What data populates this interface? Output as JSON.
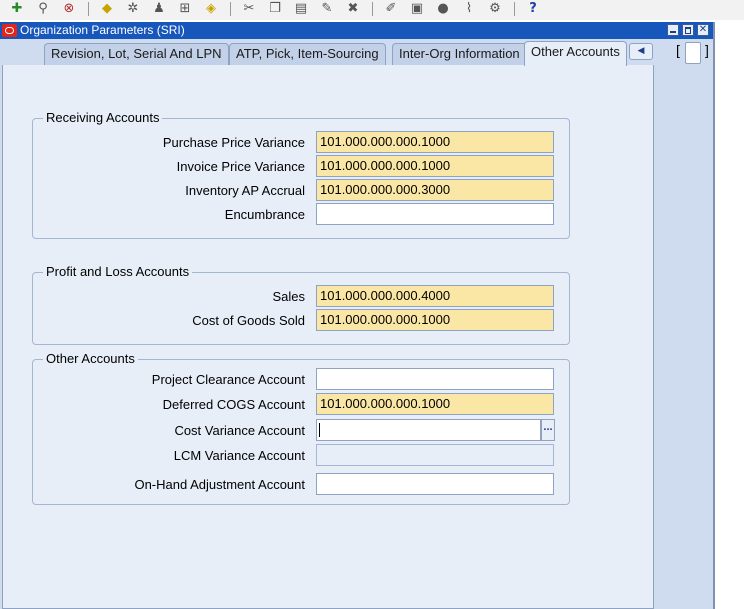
{
  "window": {
    "title": "Organization Parameters (SRI)",
    "close_glyph": "✕"
  },
  "toolbar": {
    "icons": [
      "new-record-icon",
      "find-icon",
      "navigator-icon",
      "save-icon",
      "next-step-icon",
      "switch-responsibility-icon",
      "print-icon",
      "close-form-icon",
      "cut-icon",
      "copy-icon",
      "paste-icon",
      "clear-record-icon",
      "delete-record-icon",
      "edit-field-icon",
      "zoom-icon",
      "translations-icon",
      "attachments-icon",
      "folder-tools-icon",
      "help-icon"
    ],
    "help_glyph": "?"
  },
  "tabs": [
    {
      "label": "Revision, Lot, Serial And LPN"
    },
    {
      "label": "ATP, Pick, Item-Sourcing"
    },
    {
      "label": "Inter-Org Information"
    },
    {
      "label": "Other Accounts"
    }
  ],
  "tab_scroll_glyph": "◀",
  "bracket": {
    "open": "[",
    "close": "]"
  },
  "receiving": {
    "title": "Receiving Accounts",
    "ppv_label": "Purchase Price Variance",
    "ppv_value": "101.000.000.000.1000",
    "ipv_label": "Invoice Price Variance",
    "ipv_value": "101.000.000.000.1000",
    "ap_label": "Inventory AP Accrual",
    "ap_value": "101.000.000.000.3000",
    "enc_label": "Encumbrance",
    "enc_value": ""
  },
  "profit_loss": {
    "title": "Profit and Loss Accounts",
    "sales_label": "Sales",
    "sales_value": "101.000.000.000.4000",
    "cogs_label": "Cost of Goods Sold",
    "cogs_value": "101.000.000.000.1000"
  },
  "other": {
    "title": "Other Accounts",
    "project_label": "Project Clearance Account",
    "project_value": "",
    "deferred_label": "Deferred COGS Account",
    "deferred_value": "101.000.000.000.1000",
    "costvar_label": "Cost Variance Account",
    "costvar_value": "",
    "lov_glyph": "...",
    "lcm_label": "LCM Variance Account",
    "lcm_value": "",
    "onhand_label": "On-Hand Adjustment Account",
    "onhand_value": ""
  },
  "colors": {
    "required_field": "#fbe7a5",
    "title_bar": "#1756ba",
    "form_background": "#e8eef8"
  }
}
